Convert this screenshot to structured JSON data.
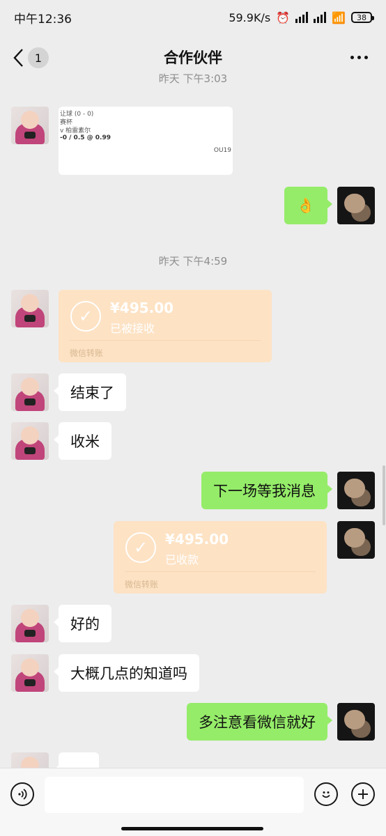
{
  "status": {
    "time": "中午12:36",
    "net_speed": "59.9K/s",
    "battery": "38"
  },
  "nav": {
    "title": "合作伙伴",
    "unread_badge": "1"
  },
  "chat": {
    "timestamp_partial": "昨天 下午3:03",
    "timestamp_2": "昨天 下午4:59",
    "card": {
      "line1": "让球 (0 - 0)",
      "line2": "赛杯",
      "line3": "v 柏雷素尔",
      "line4": "-0 / 0.5 @ 0.99",
      "code": "OU19"
    },
    "emoji_ok": "👌",
    "transfer_received": {
      "amount": "¥495.00",
      "status": "已被接收",
      "footer": "微信转账"
    },
    "msg_done": "结束了",
    "msg_collect": "收米",
    "msg_next_game": "下一场等我消息",
    "transfer_collected": {
      "amount": "¥495.00",
      "status": "已收款",
      "footer": "微信转账"
    },
    "msg_ok": "好的",
    "msg_when": "大概几点的知道吗",
    "msg_watch": "多注意看微信就好"
  },
  "icons": {
    "voice": "voice-icon",
    "emoji": "emoji-icon",
    "plus": "plus-icon"
  }
}
